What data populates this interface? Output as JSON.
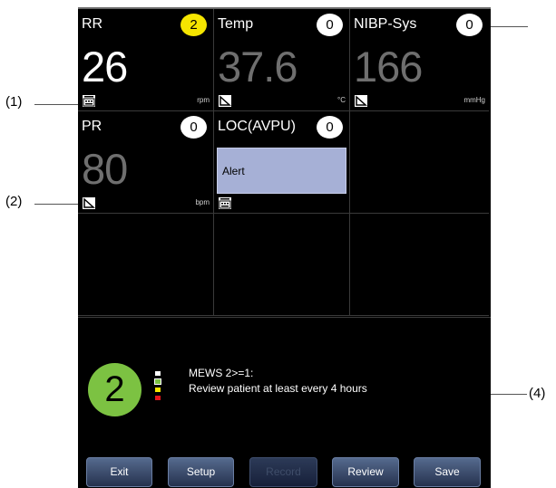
{
  "callouts": [
    "(1)",
    "(2)",
    "(4)"
  ],
  "parameters": [
    {
      "label": "RR",
      "score": "2",
      "value": "26",
      "unit": "rpm",
      "source_icon": "keyboard-icon"
    },
    {
      "label": "Temp",
      "score": "0",
      "value": "37.6",
      "unit": "°C",
      "source_icon": "measurement-icon"
    },
    {
      "label": "NIBP-Sys",
      "score": "0",
      "value": "166",
      "unit": "mmHg",
      "source_icon": "measurement-icon"
    },
    {
      "label": "PR",
      "score": "0",
      "value": "80",
      "unit": "bpm",
      "source_icon": "measurement-icon"
    },
    {
      "label": "LOC(AVPU)",
      "score": "0",
      "value": "Alert",
      "source_icon": "keyboard-icon"
    }
  ],
  "summary": {
    "total_score": "2",
    "title": "MEWS 2>=1:",
    "recommendation": "Review patient at least every 4 hours",
    "level_colors": [
      "#ffffff",
      "#7cc242",
      "#f5e500",
      "#e8151b"
    ]
  },
  "buttons": {
    "exit": "Exit",
    "setup": "Setup",
    "record": "Record",
    "review": "Review",
    "save": "Save"
  },
  "colors": {
    "yellow_score": "#f5e500",
    "green_total": "#7cc242",
    "loc_box": "#a6b0d6"
  }
}
